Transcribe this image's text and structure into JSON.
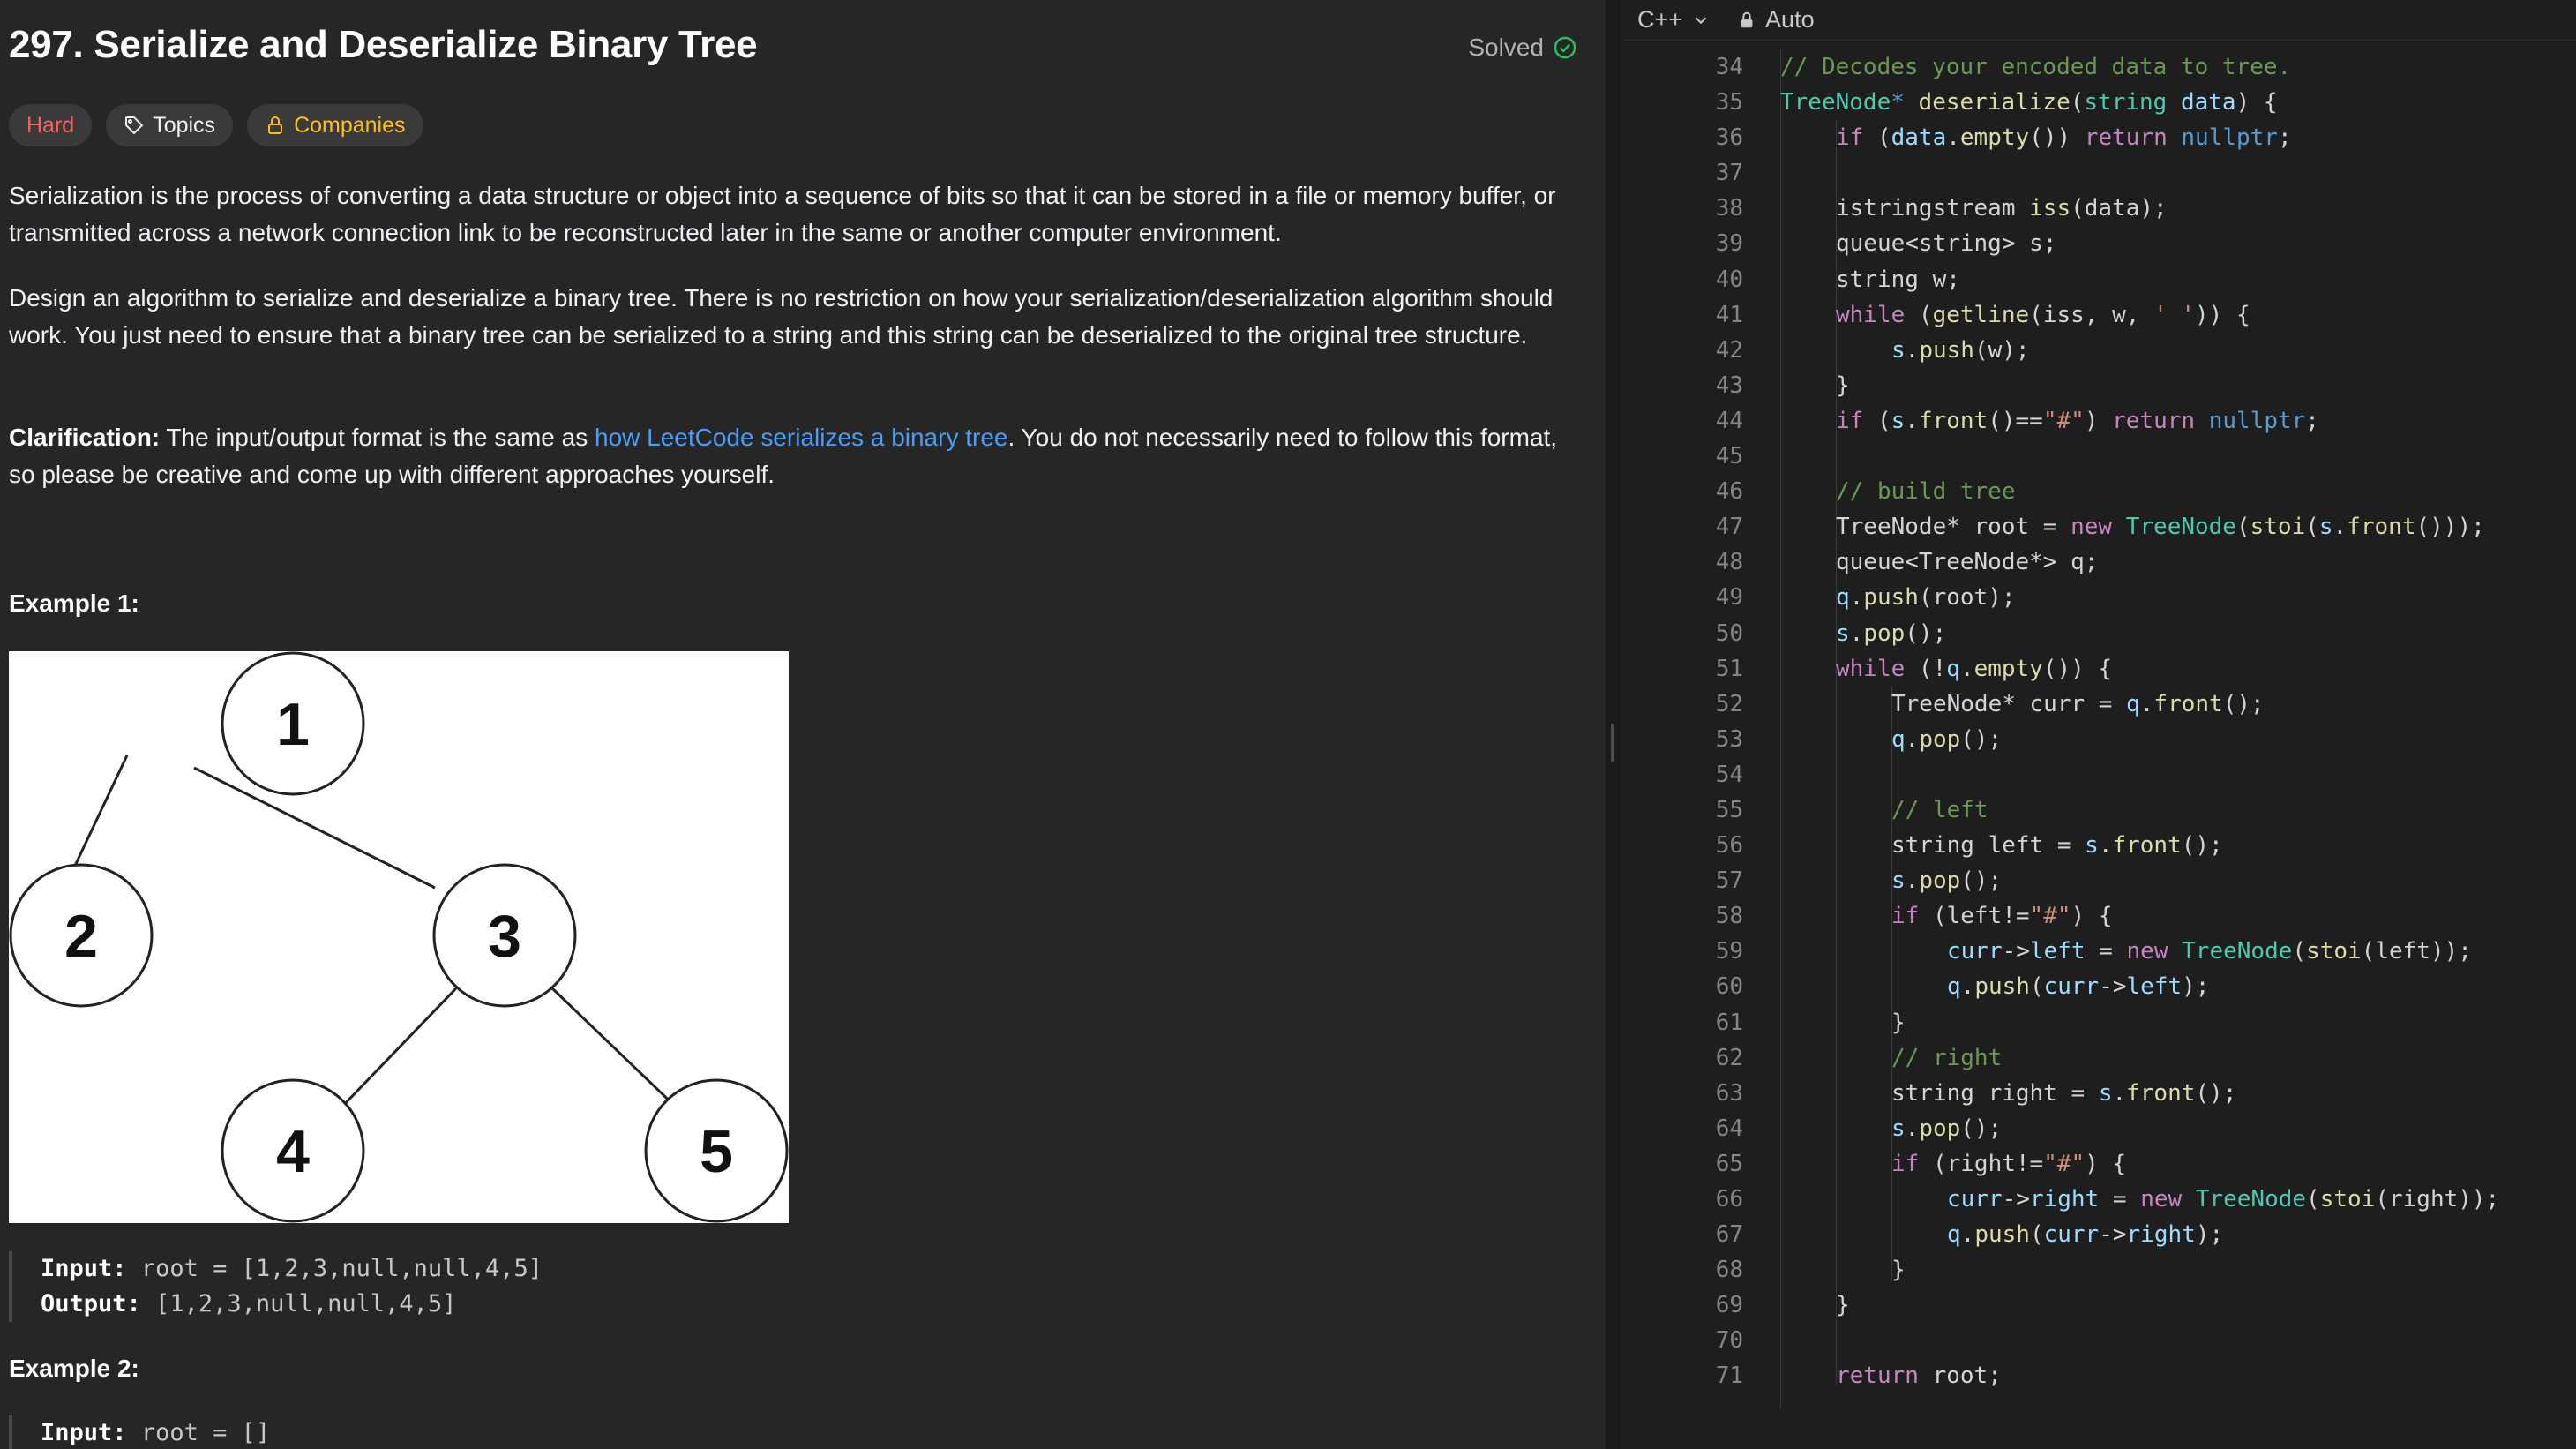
{
  "problem": {
    "title": "297. Serialize and Deserialize Binary Tree",
    "status": "Solved",
    "tags": {
      "difficulty": "Hard",
      "topics": "Topics",
      "companies": "Companies"
    },
    "description": {
      "p1": "Serialization is the process of converting a data structure or object into a sequence of bits so that it can be stored in a file or memory buffer, or transmitted across a network connection link to be reconstructed later in the same or another computer environment.",
      "p2": "Design an algorithm to serialize and deserialize a binary tree. There is no restriction on how your serialization/deserialization algorithm should work. You just need to ensure that a binary tree can be serialized to a string and this string can be deserialized to the original tree structure.",
      "p3_label": "Clarification:",
      "p3_before": " The input/output format is the same as ",
      "p3_link": "how LeetCode serializes a binary tree",
      "p3_after": ". You do not necessarily need to follow this format, so please be creative and come up with different approaches yourself."
    },
    "examples": [
      {
        "title": "Example 1:",
        "input_label": "Input:",
        "input": "root = [1,2,3,null,null,4,5]",
        "output_label": "Output:",
        "output": "[1,2,3,null,null,4,5]",
        "tree_nodes": [
          "1",
          "2",
          "3",
          "4",
          "5"
        ]
      },
      {
        "title": "Example 2:",
        "input_label": "Input:",
        "input": "root = []"
      }
    ]
  },
  "editor": {
    "language": "C++",
    "mode": "Auto",
    "code_lines": [
      {
        "n": "34",
        "indent": 1,
        "tokens": [
          [
            "cm",
            "// Decodes your encoded data to tree."
          ]
        ]
      },
      {
        "n": "35",
        "indent": 1,
        "tokens": [
          [
            "ty",
            "TreeNode"
          ],
          [
            "nl",
            "*"
          ],
          [
            "",
            " "
          ],
          [
            "fn",
            "deserialize"
          ],
          [
            "",
            "("
          ],
          [
            "ty",
            "string"
          ],
          [
            "",
            " "
          ],
          [
            "vr",
            "data"
          ],
          [
            "",
            ") {"
          ]
        ]
      },
      {
        "n": "36",
        "indent": 2,
        "tokens": [
          [
            "kw",
            "if"
          ],
          [
            "",
            " ("
          ],
          [
            "vr",
            "data"
          ],
          [
            "",
            "."
          ],
          [
            "fn",
            "empty"
          ],
          [
            "",
            "()) "
          ],
          [
            "kw",
            "return"
          ],
          [
            "",
            " "
          ],
          [
            "nl",
            "nullptr"
          ],
          [
            "",
            ";"
          ]
        ]
      },
      {
        "n": "37",
        "indent": 0,
        "tokens": []
      },
      {
        "n": "38",
        "indent": 2,
        "tokens": [
          [
            "",
            "istringstream "
          ],
          [
            "fn",
            "iss"
          ],
          [
            "",
            "(data);"
          ]
        ]
      },
      {
        "n": "39",
        "indent": 2,
        "tokens": [
          [
            "",
            "queue<string> s;"
          ]
        ]
      },
      {
        "n": "40",
        "indent": 2,
        "tokens": [
          [
            "",
            "string w;"
          ]
        ]
      },
      {
        "n": "41",
        "indent": 2,
        "tokens": [
          [
            "kw",
            "while"
          ],
          [
            "",
            " ("
          ],
          [
            "fn",
            "getline"
          ],
          [
            "",
            "(iss, w, "
          ],
          [
            "st",
            "' '"
          ],
          [
            "",
            ")) {"
          ]
        ]
      },
      {
        "n": "42",
        "indent": 3,
        "tokens": [
          [
            "vr",
            "s"
          ],
          [
            "",
            "."
          ],
          [
            "fn",
            "push"
          ],
          [
            "",
            "(w);"
          ]
        ]
      },
      {
        "n": "43",
        "indent": 2,
        "tokens": [
          [
            "",
            "}"
          ]
        ]
      },
      {
        "n": "44",
        "indent": 2,
        "tokens": [
          [
            "kw",
            "if"
          ],
          [
            "",
            " ("
          ],
          [
            "vr",
            "s"
          ],
          [
            "",
            "."
          ],
          [
            "fn",
            "front"
          ],
          [
            "",
            "()=="
          ],
          [
            "st",
            "\"#\""
          ],
          [
            "",
            ") "
          ],
          [
            "kw",
            "return"
          ],
          [
            "",
            " "
          ],
          [
            "nl",
            "nullptr"
          ],
          [
            "",
            ";"
          ]
        ]
      },
      {
        "n": "45",
        "indent": 0,
        "tokens": []
      },
      {
        "n": "46",
        "indent": 2,
        "tokens": [
          [
            "cm",
            "// build tree"
          ]
        ]
      },
      {
        "n": "47",
        "indent": 2,
        "tokens": [
          [
            "",
            "TreeNode* root = "
          ],
          [
            "kw",
            "new"
          ],
          [
            "",
            " "
          ],
          [
            "ty",
            "TreeNode"
          ],
          [
            "",
            "("
          ],
          [
            "fn",
            "stoi"
          ],
          [
            "",
            "("
          ],
          [
            "vr",
            "s"
          ],
          [
            "",
            "."
          ],
          [
            "fn",
            "front"
          ],
          [
            "",
            "()));"
          ]
        ]
      },
      {
        "n": "48",
        "indent": 2,
        "tokens": [
          [
            "",
            "queue<TreeNode*> q;"
          ]
        ]
      },
      {
        "n": "49",
        "indent": 2,
        "tokens": [
          [
            "vr",
            "q"
          ],
          [
            "",
            "."
          ],
          [
            "fn",
            "push"
          ],
          [
            "",
            "(root);"
          ]
        ]
      },
      {
        "n": "50",
        "indent": 2,
        "tokens": [
          [
            "vr",
            "s"
          ],
          [
            "",
            "."
          ],
          [
            "fn",
            "pop"
          ],
          [
            "",
            "();"
          ]
        ]
      },
      {
        "n": "51",
        "indent": 2,
        "tokens": [
          [
            "kw",
            "while"
          ],
          [
            "",
            " (!"
          ],
          [
            "vr",
            "q"
          ],
          [
            "",
            "."
          ],
          [
            "fn",
            "empty"
          ],
          [
            "",
            "()) {"
          ]
        ]
      },
      {
        "n": "52",
        "indent": 3,
        "tokens": [
          [
            "",
            "TreeNode* curr = "
          ],
          [
            "vr",
            "q"
          ],
          [
            "",
            "."
          ],
          [
            "fn",
            "front"
          ],
          [
            "",
            "();"
          ]
        ]
      },
      {
        "n": "53",
        "indent": 3,
        "tokens": [
          [
            "vr",
            "q"
          ],
          [
            "",
            "."
          ],
          [
            "fn",
            "pop"
          ],
          [
            "",
            "();"
          ]
        ]
      },
      {
        "n": "54",
        "indent": 0,
        "tokens": []
      },
      {
        "n": "55",
        "indent": 3,
        "tokens": [
          [
            "cm",
            "// left"
          ]
        ]
      },
      {
        "n": "56",
        "indent": 3,
        "tokens": [
          [
            "",
            "string left = "
          ],
          [
            "vr",
            "s"
          ],
          [
            "",
            "."
          ],
          [
            "fn",
            "front"
          ],
          [
            "",
            "();"
          ]
        ]
      },
      {
        "n": "57",
        "indent": 3,
        "tokens": [
          [
            "vr",
            "s"
          ],
          [
            "",
            "."
          ],
          [
            "fn",
            "pop"
          ],
          [
            "",
            "();"
          ]
        ]
      },
      {
        "n": "58",
        "indent": 3,
        "tokens": [
          [
            "kw",
            "if"
          ],
          [
            "",
            " (left!="
          ],
          [
            "st",
            "\"#\""
          ],
          [
            "",
            ") {"
          ]
        ]
      },
      {
        "n": "59",
        "indent": 4,
        "tokens": [
          [
            "vr",
            "curr"
          ],
          [
            "",
            "->"
          ],
          [
            "vr",
            "left"
          ],
          [
            "",
            " = "
          ],
          [
            "kw",
            "new"
          ],
          [
            "",
            " "
          ],
          [
            "ty",
            "TreeNode"
          ],
          [
            "",
            "("
          ],
          [
            "fn",
            "stoi"
          ],
          [
            "",
            "(left));"
          ]
        ]
      },
      {
        "n": "60",
        "indent": 4,
        "tokens": [
          [
            "vr",
            "q"
          ],
          [
            "",
            "."
          ],
          [
            "fn",
            "push"
          ],
          [
            "",
            "("
          ],
          [
            "vr",
            "curr"
          ],
          [
            "",
            "->"
          ],
          [
            "vr",
            "left"
          ],
          [
            "",
            ");"
          ]
        ]
      },
      {
        "n": "61",
        "indent": 3,
        "tokens": [
          [
            "",
            "}"
          ]
        ]
      },
      {
        "n": "62",
        "indent": 3,
        "tokens": [
          [
            "cm",
            "// right"
          ]
        ]
      },
      {
        "n": "63",
        "indent": 3,
        "tokens": [
          [
            "",
            "string right = "
          ],
          [
            "vr",
            "s"
          ],
          [
            "",
            "."
          ],
          [
            "fn",
            "front"
          ],
          [
            "",
            "();"
          ]
        ]
      },
      {
        "n": "64",
        "indent": 3,
        "tokens": [
          [
            "vr",
            "s"
          ],
          [
            "",
            "."
          ],
          [
            "fn",
            "pop"
          ],
          [
            "",
            "();"
          ]
        ]
      },
      {
        "n": "65",
        "indent": 3,
        "tokens": [
          [
            "kw",
            "if"
          ],
          [
            "",
            " (right!="
          ],
          [
            "st",
            "\"#\""
          ],
          [
            "",
            ") {"
          ]
        ]
      },
      {
        "n": "66",
        "indent": 4,
        "tokens": [
          [
            "vr",
            "curr"
          ],
          [
            "",
            "->"
          ],
          [
            "vr",
            "right"
          ],
          [
            "",
            " = "
          ],
          [
            "kw",
            "new"
          ],
          [
            "",
            " "
          ],
          [
            "ty",
            "TreeNode"
          ],
          [
            "",
            "("
          ],
          [
            "fn",
            "stoi"
          ],
          [
            "",
            "(right));"
          ]
        ]
      },
      {
        "n": "67",
        "indent": 4,
        "tokens": [
          [
            "vr",
            "q"
          ],
          [
            "",
            "."
          ],
          [
            "fn",
            "push"
          ],
          [
            "",
            "("
          ],
          [
            "vr",
            "curr"
          ],
          [
            "",
            "->"
          ],
          [
            "vr",
            "right"
          ],
          [
            "",
            ");"
          ]
        ]
      },
      {
        "n": "68",
        "indent": 3,
        "tokens": [
          [
            "",
            "}"
          ]
        ]
      },
      {
        "n": "69",
        "indent": 2,
        "tokens": [
          [
            "",
            "}"
          ]
        ]
      },
      {
        "n": "70",
        "indent": 0,
        "tokens": []
      },
      {
        "n": "71",
        "indent": 2,
        "tokens": [
          [
            "kw",
            "return"
          ],
          [
            "",
            " root;"
          ]
        ]
      }
    ]
  },
  "colors": {
    "difficulty_hard": "#f8615c",
    "companies": "#ffc01e",
    "link": "#4a9df8",
    "solved_check": "#2cbb5d"
  }
}
